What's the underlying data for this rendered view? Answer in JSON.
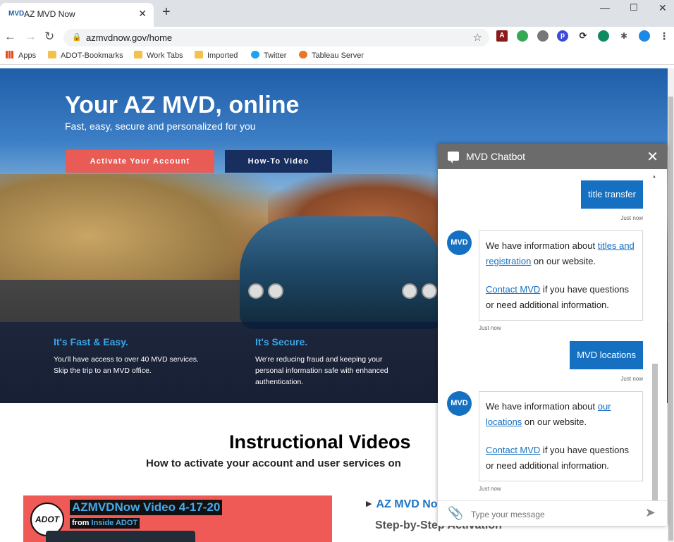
{
  "browser": {
    "tab_title": "AZ MVD Now",
    "tab_favicon": "MVD",
    "url": "azmvdnow.gov/home",
    "bookmarks": [
      {
        "label": "Apps",
        "color": "#e64a19"
      },
      {
        "label": "ADOT-Bookmarks",
        "color": "#f2c14e"
      },
      {
        "label": "Work Tabs",
        "color": "#f2c14e"
      },
      {
        "label": "Imported",
        "color": "#f2c14e"
      },
      {
        "label": "Twitter",
        "color": "#1da1f2"
      },
      {
        "label": "Tableau Server",
        "color": "#e97627"
      }
    ]
  },
  "hero": {
    "title": "Your AZ MVD, online",
    "subtitle": "Fast, easy, secure and personalized for you",
    "activate_label": "Activate Your Account",
    "video_label": "How-To Video"
  },
  "features": [
    {
      "heading": "It's Fast & Easy.",
      "text": "You'll have access to over 40 MVD services. Skip the trip to an MVD office."
    },
    {
      "heading": "It's Secure.",
      "text": "We're reducing fraud and keeping your personal information safe with enhanced authentication."
    }
  ],
  "videos": {
    "title": "Instructional Videos",
    "subtitle": "How to activate your account and user services on",
    "thumb_logo": "ADOT",
    "thumb_title": "AZMVDNow Video 4-17-20",
    "thumb_from": "from",
    "thumb_source": "Inside ADOT",
    "link_label": "AZ MVD No",
    "step_text": "Step-by-Step Activation"
  },
  "chat": {
    "title": "MVD Chatbot",
    "avatar_label": "MVD",
    "messages": [
      {
        "user_text": "title transfer",
        "user_time": "Just now",
        "bot_pre": "We have information about ",
        "bot_link": "titles and registration",
        "bot_post": " on our website.",
        "contact_link": "Contact MVD",
        "contact_post": " if you have questions or need additional information.",
        "bot_time": "Just now"
      },
      {
        "user_text": "MVD locations",
        "user_time": "Just now",
        "bot_pre": "We have information about ",
        "bot_link": "our locations",
        "bot_post": " on our website.",
        "contact_link": "Contact MVD",
        "contact_post": " if you have questions or need additional information.",
        "bot_time": "Just now"
      }
    ],
    "input_placeholder": "Type your message"
  },
  "colors": {
    "accent_red": "#e85c55",
    "navy": "#182e5e",
    "chat_blue": "#1670c2",
    "feature_blue": "#3aa5e6"
  }
}
